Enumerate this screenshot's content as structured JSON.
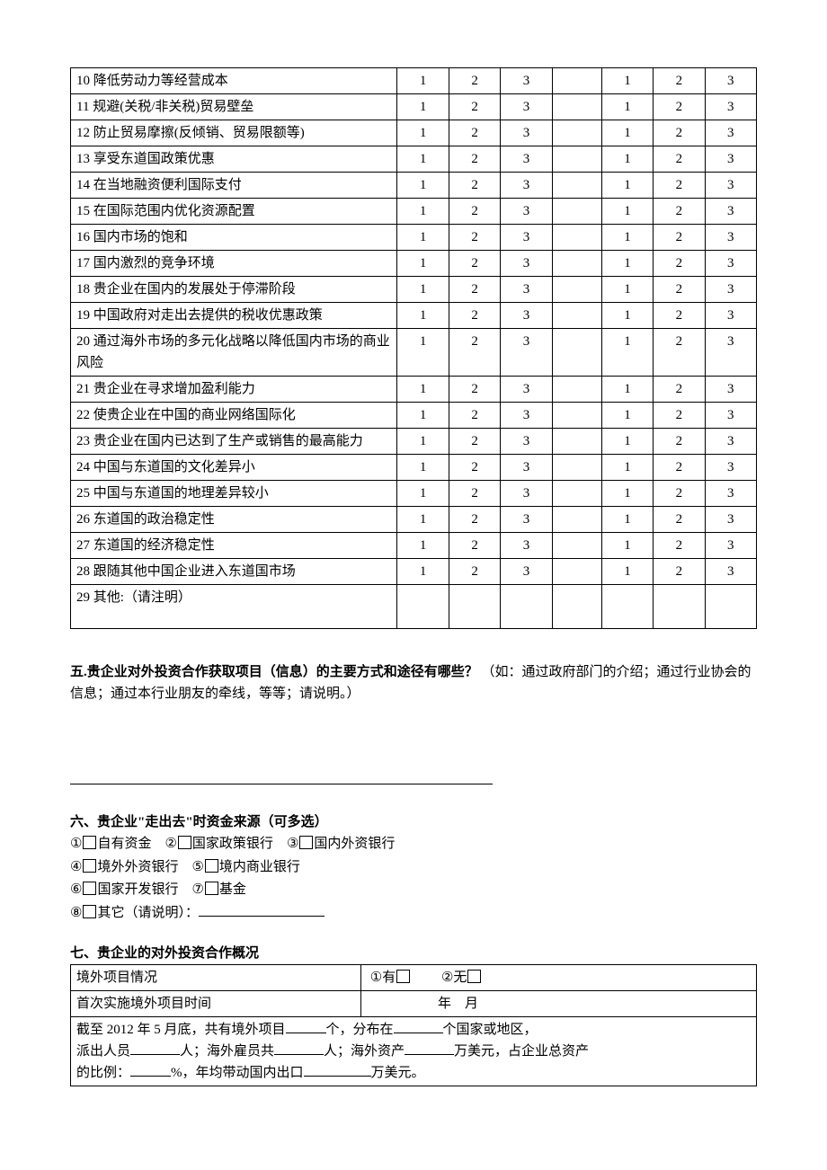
{
  "table_rows": [
    {
      "label": "10 降低劳动力等经营成本",
      "type": "normal"
    },
    {
      "label": "11 规避(关税/非关税)贸易壁垒",
      "type": "normal"
    },
    {
      "label": "12 防止贸易摩擦(反倾销、贸易限额等)",
      "type": "normal"
    },
    {
      "label": "13 享受东道国政策优惠",
      "type": "normal"
    },
    {
      "label": "14 在当地融资便利国际支付",
      "type": "normal"
    },
    {
      "label": "15 在国际范围内优化资源配置",
      "type": "normal"
    },
    {
      "label": "16 国内市场的饱和",
      "type": "normal"
    },
    {
      "label": "17 国内激烈的竞争环境",
      "type": "normal"
    },
    {
      "label": "18 贵企业在国内的发展处于停滞阶段",
      "type": "normal"
    },
    {
      "label": "19 中国政府对走出去提供的税收优惠政策",
      "type": "normal"
    },
    {
      "label": "20 通过海外市场的多元化战略以降低国内市场的商业风险",
      "type": "twoline"
    },
    {
      "label": "21 贵企业在寻求增加盈利能力",
      "type": "normal"
    },
    {
      "label": "22 使贵企业在中国的商业网络国际化",
      "type": "normal"
    },
    {
      "label": "23 贵企业在国内已达到了生产或销售的最高能力",
      "type": "twoline"
    },
    {
      "label": "24 中国与东道国的文化差异小",
      "type": "normal"
    },
    {
      "label": "25 中国与东道国的地理差异较小",
      "type": "normal"
    },
    {
      "label": "26 东道国的政治稳定性",
      "type": "normal"
    },
    {
      "label": "27 东道国的经济稳定性",
      "type": "normal"
    },
    {
      "label": "28 跟随其他中国企业进入东道国市场",
      "type": "normal"
    },
    {
      "label": "29 其他:（请注明）",
      "type": "other"
    }
  ],
  "scale": [
    "1",
    "2",
    "3"
  ],
  "q5": {
    "heading_bold": "五.贵企业对外投资合作获取项目（信息）的主要方式和途径有哪些？",
    "heading_rest": "（如：通过政府部门的介绍；通过行业协会的信息；通过本行业朋友的牵线，等等；请说明。）"
  },
  "q6": {
    "heading": "六、贵企业\"走出去\"时资金来源（可多选）",
    "opts": [
      {
        "n": "①",
        "t": "自有资金"
      },
      {
        "n": "②",
        "t": "国家政策银行"
      },
      {
        "n": "③",
        "t": "国内外资银行"
      },
      {
        "n": "④",
        "t": "境外外资银行"
      },
      {
        "n": "⑤",
        "t": "境内商业银行"
      },
      {
        "n": "⑥",
        "t": "国家开发银行"
      },
      {
        "n": "⑦",
        "t": "基金"
      },
      {
        "n": "⑧",
        "t": "其它（请说明）："
      }
    ]
  },
  "q7": {
    "heading": "七、贵企业的对外投资合作概况",
    "row1_label": "境外项目情况",
    "row1_opt1_num": "①",
    "row1_opt1_text": "有",
    "row1_opt2_num": "②",
    "row1_opt2_text": "无",
    "row2_label": "首次实施境外项目时间",
    "row2_year": "年",
    "row2_month": "月",
    "row3_prefix": "截至 2012 年 5 月底，共有境外项目",
    "row3_t1": "个，分布在",
    "row3_t2": "个国家或地区，",
    "row3_t3": "派出人员",
    "row3_t4": "人；海外雇员共",
    "row3_t5": "人；海外资产",
    "row3_t6": "万美元，占企业总资产",
    "row3_t7": "的比例：",
    "row3_t8": "%，年均带动国内出口",
    "row3_t9": "万美元。"
  }
}
